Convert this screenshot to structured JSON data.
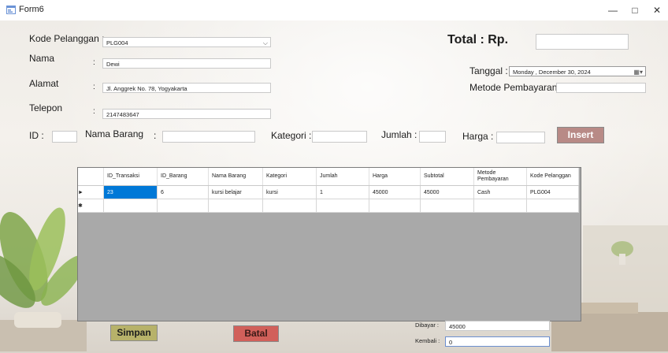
{
  "window": {
    "title": "Form6",
    "minimize_glyph": "—",
    "maximize_glyph": "□",
    "close_glyph": "✕"
  },
  "form": {
    "kode_pelanggan_label": "Kode Pelanggan :",
    "kode_pelanggan_value": "PLG004",
    "nama_label": "Nama",
    "nama_colon": ":",
    "nama_value": "Dewi",
    "alamat_label": "Alamat",
    "alamat_colon": ":",
    "alamat_value": "Jl. Anggrek No. 78, Yogyakarta",
    "telepon_label": "Telepon",
    "telepon_colon": ":",
    "telepon_value": "2147483647",
    "total_label": "Total : Rp.",
    "total_value": "",
    "tanggal_label": "Tanggal :",
    "tanggal_value": "Monday    ,  December 30, 2024",
    "metode_label": "Metode Pembayaran :",
    "metode_value": "",
    "id_label": "ID :",
    "id_value": "",
    "nama_barang_label": "Nama Barang",
    "nama_barang_colon": ":",
    "nama_barang_value": "",
    "kategori_label": "Kategori :",
    "kategori_value": "",
    "jumlah_label": "Jumlah :",
    "jumlah_value": "",
    "harga_label": "Harga :",
    "harga_value": "",
    "insert_label": "Insert",
    "simpan_label": "Simpan",
    "batal_label": "Batal",
    "dibayar_label": "Dibayar :",
    "dibayar_value": "45000",
    "kembali_label": "Kembali :",
    "kembali_value": "0"
  },
  "grid": {
    "headers": [
      "ID_Transaksi",
      "ID_Barang",
      "Nama Barang",
      "Kategori",
      "Jumlah",
      "Harga",
      "Subtotal",
      "Metode Pembayaran",
      "Kode Pelanggan"
    ],
    "rows": [
      [
        "23",
        "6",
        "kursi belajar",
        "kursi",
        "1",
        "45000",
        "45000",
        "Cash",
        "PLG004"
      ]
    ],
    "current_row_marker": "►",
    "new_row_marker": "✱"
  },
  "colors": {
    "insert_button": "#b88a86",
    "simpan_button": "#b7b26a",
    "batal_button": "#d1605a",
    "selected_cell": "#0078d7"
  }
}
